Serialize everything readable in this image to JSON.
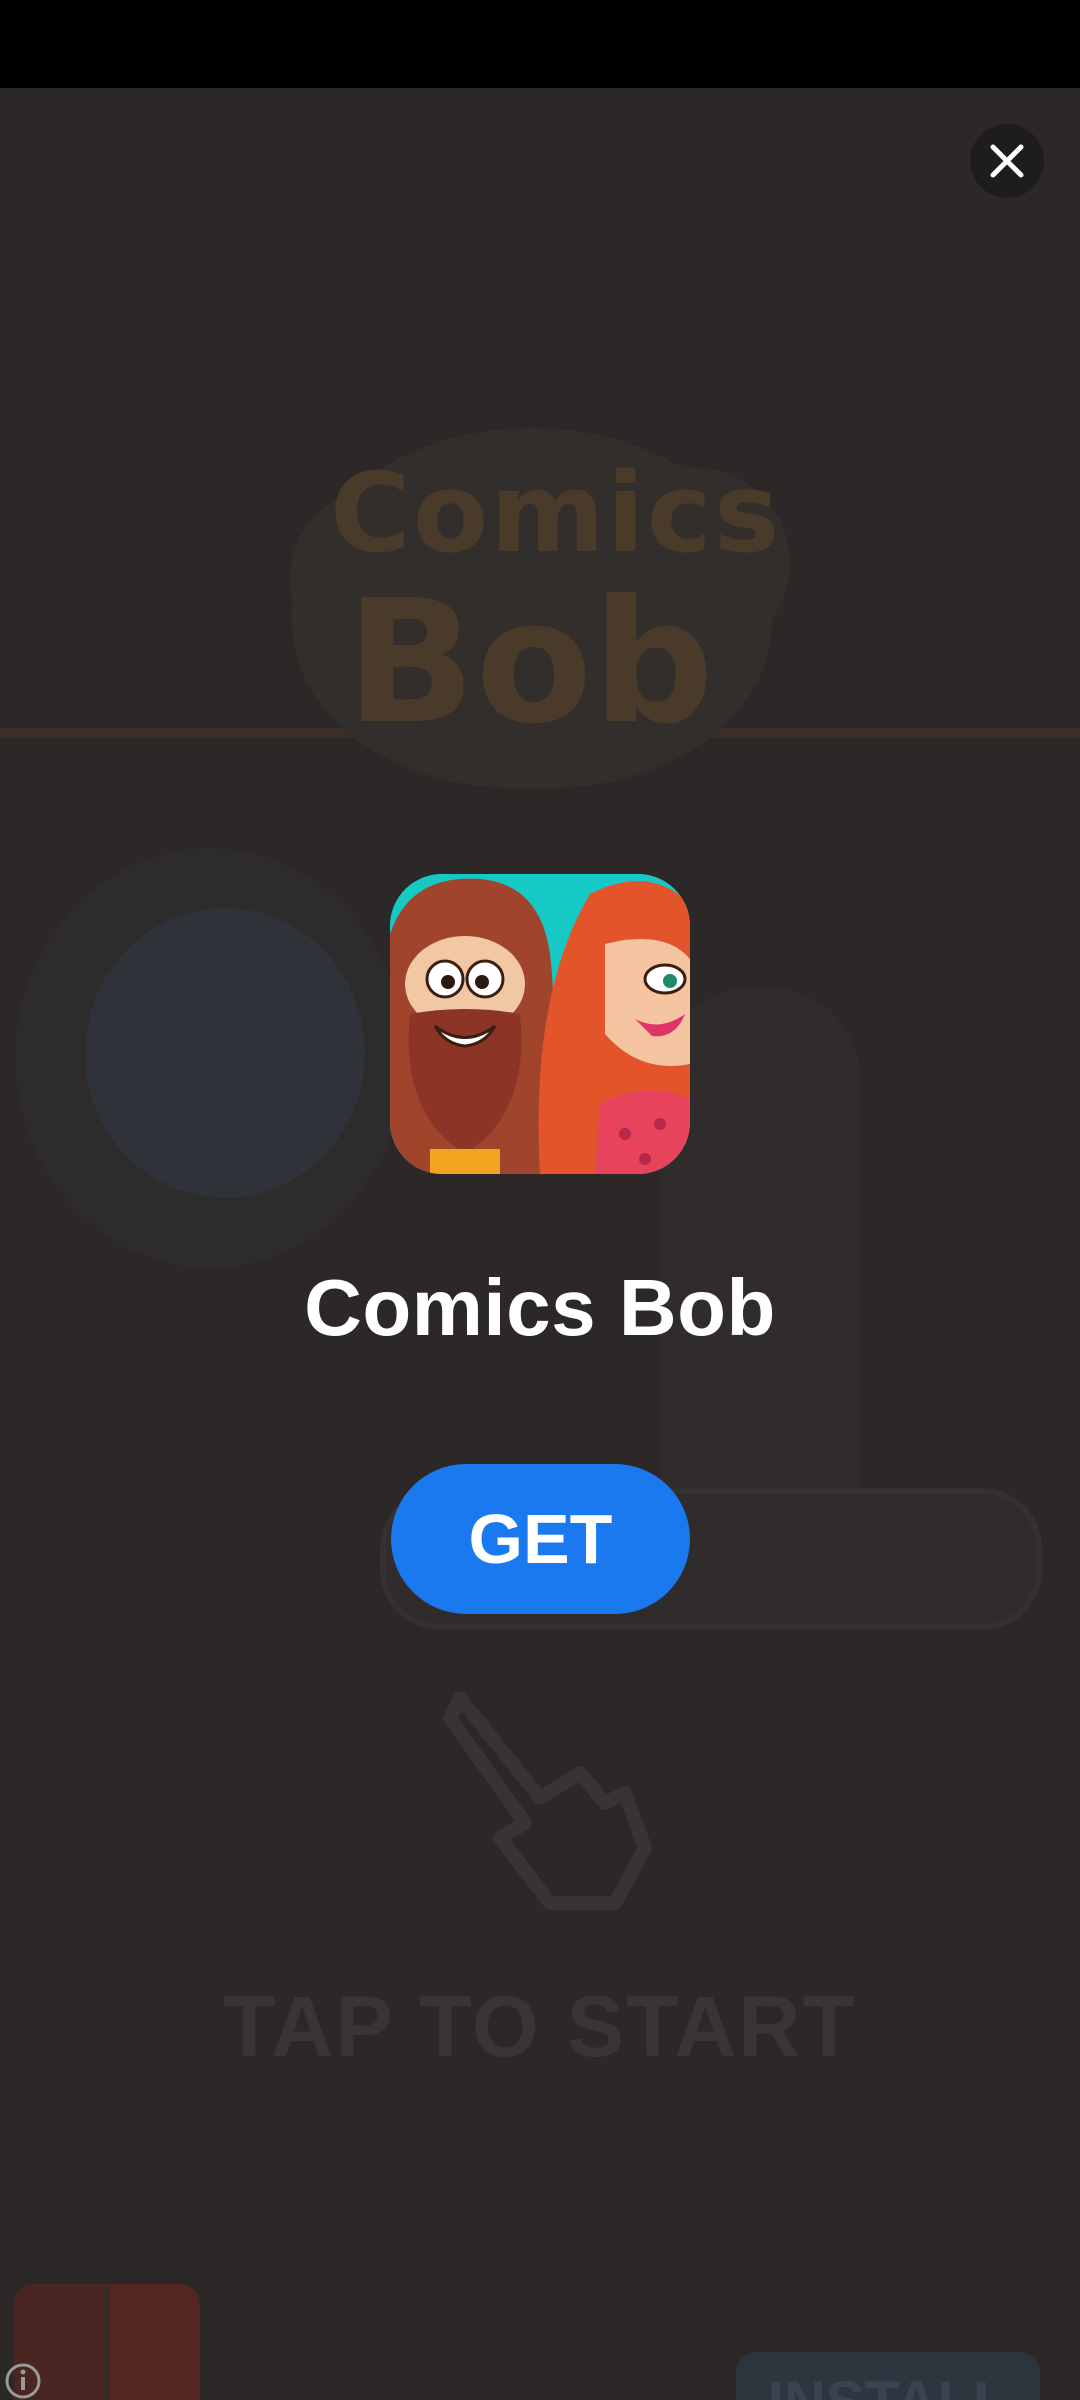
{
  "background": {
    "logo_line1": "Comics",
    "logo_line2": "Bob",
    "tap_to_start": "TAP TO START",
    "install_label": "INSTALL"
  },
  "overlay": {
    "app_name": "Comics Bob",
    "get_label": "GET",
    "close_icon": "close-icon",
    "info_icon": "info-icon"
  },
  "colors": {
    "get_button": "#1b79f0",
    "dim_background": "#2b2827",
    "status_bar": "#000000"
  }
}
